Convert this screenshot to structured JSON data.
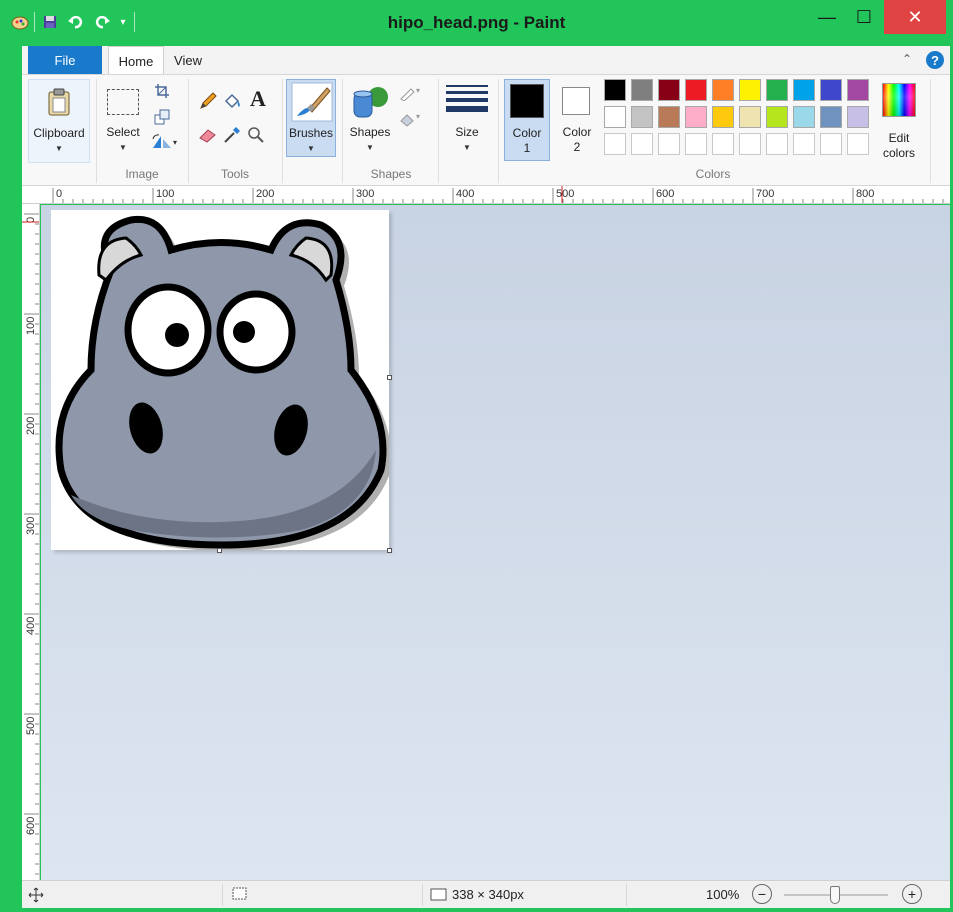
{
  "window": {
    "title": "hipo_head.png - Paint",
    "accent_color": "#22c55a",
    "close_color": "#e04343",
    "min_label": "—",
    "max_label": "☐",
    "close_label": "✕"
  },
  "quick_access": [
    "paint-icon",
    "save-icon",
    "undo-icon",
    "redo-icon",
    "customize-icon"
  ],
  "tabs": [
    {
      "label": "File"
    },
    {
      "label": "Home"
    },
    {
      "label": "View"
    }
  ],
  "help_label": "?",
  "ribbon": {
    "clipboard": {
      "label": "Clipboard"
    },
    "image": {
      "group_label": "Image",
      "select_label": "Select"
    },
    "tools": {
      "group_label": "Tools"
    },
    "brushes": {
      "label": "Brushes"
    },
    "shapes": {
      "label": "Shapes",
      "group_label": "Shapes"
    },
    "size": {
      "label": "Size"
    },
    "color1": {
      "label_line1": "Color",
      "label_line2": "1",
      "value": "#000000"
    },
    "color2": {
      "label_line1": "Color",
      "label_line2": "2",
      "value": "#ffffff"
    },
    "colors_group_label": "Colors",
    "edit_colors": {
      "line1": "Edit",
      "line2": "colors"
    },
    "palette_row1": [
      "#000000",
      "#7f7f7f",
      "#880015",
      "#ed1c24",
      "#ff7f27",
      "#fff200",
      "#22b14c",
      "#00a2e8",
      "#3f48cc",
      "#a349a4"
    ],
    "palette_row2": [
      "#ffffff",
      "#c3c3c3",
      "#b97a57",
      "#ffaec9",
      "#ffc90e",
      "#efe4b0",
      "#b5e61d",
      "#99d9ea",
      "#7092be",
      "#c8bfe7"
    ]
  },
  "ruler": {
    "h_labels": [
      "0",
      "100",
      "200",
      "300",
      "400",
      "500",
      "600",
      "700",
      "800"
    ],
    "v_labels": [
      "0",
      "100",
      "200",
      "300",
      "400",
      "500",
      "600"
    ]
  },
  "status": {
    "image_size": "338 × 340px",
    "zoom": "100%",
    "zoom_out": "−",
    "zoom_in": "+"
  }
}
